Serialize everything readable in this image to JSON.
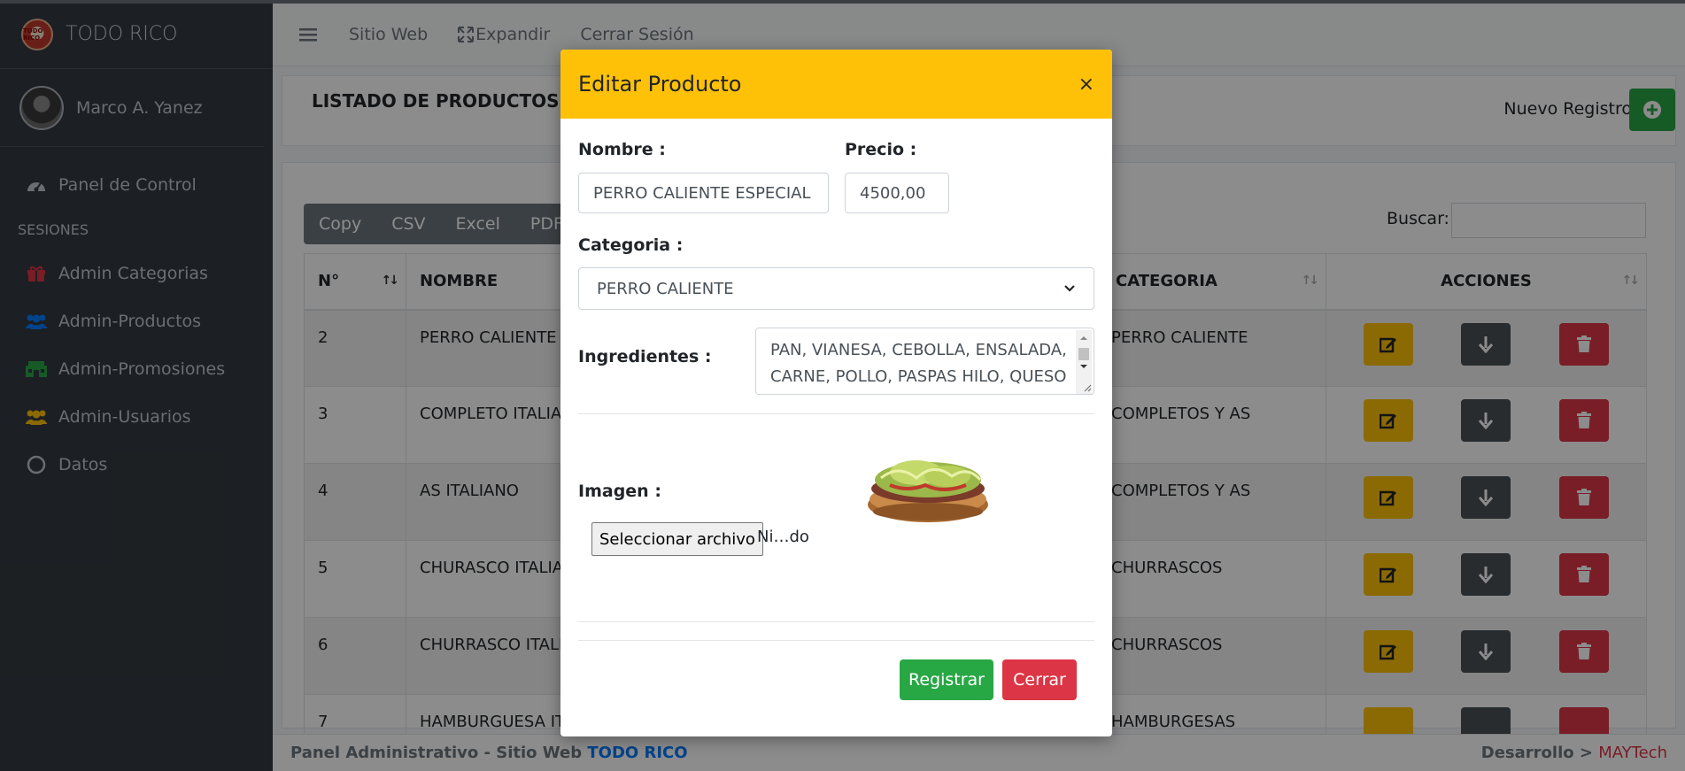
{
  "brand": {
    "name": "TODO RICO",
    "logo_text": "TODO RICO"
  },
  "user": {
    "name": "Marco A. Yanez"
  },
  "sidebar": {
    "items": [
      {
        "label": "Panel de Control",
        "icon": "tachometer-icon"
      },
      {
        "header": "SESIONES"
      },
      {
        "label": "Admin Categorias",
        "icon": "gift-icon",
        "color": "#dc3545"
      },
      {
        "label": "Admin-Productos",
        "icon": "users-icon",
        "color": "#007bff"
      },
      {
        "label": "Admin-Promosiones",
        "icon": "store-icon",
        "color": "#28a745"
      },
      {
        "label": "Admin-Usuarios",
        "icon": "users-icon",
        "color": "#ffc107"
      },
      {
        "label": "Datos",
        "icon": "circle-icon"
      }
    ]
  },
  "navbar": {
    "links": [
      "Sitio Web",
      "Expandir",
      "Cerrar Sesión"
    ]
  },
  "page": {
    "title": "LISTADO DE PRODUCTOS",
    "new_record": "Nuevo Registro",
    "export_buttons": [
      "Copy",
      "CSV",
      "Excel",
      "PDF"
    ],
    "search_label": "Buscar:",
    "columns": [
      "N°",
      "NOMBRE",
      "CATEGORIA",
      "ACCIONES"
    ],
    "rows": [
      {
        "n": "2",
        "nombre": "PERRO CALIENTE E",
        "categoria": "PERRO CALIENTE"
      },
      {
        "n": "3",
        "nombre": "COMPLETO ITALIAN",
        "categoria": "COMPLETOS Y AS"
      },
      {
        "n": "4",
        "nombre": "AS ITALIANO",
        "categoria": "COMPLETOS Y AS"
      },
      {
        "n": "5",
        "nombre": "CHURASCO ITALIAN",
        "categoria": "CHURRASCOS"
      },
      {
        "n": "6",
        "nombre": "CHURRASCO ITALIA",
        "categoria": "CHURRASCOS"
      },
      {
        "n": "7",
        "nombre": "HAMBURGUESA IT",
        "categoria": "HAMBURGESAS"
      }
    ]
  },
  "footer": {
    "left_prefix": "Panel Administrativo - Sitio Web ",
    "left_brand": "TODO RICO",
    "right_prefix": "Desarrollo > ",
    "right_brand": "MAYTech"
  },
  "modal": {
    "title": "Editar Producto",
    "close": "×",
    "nombre_label": "Nombre :",
    "nombre_value": "PERRO CALIENTE ESPECIAL",
    "precio_label": "Precio :",
    "precio_value": "4500,00",
    "categoria_label": "Categoria :",
    "categoria_value": "PERRO CALIENTE",
    "ingredientes_label": "Ingredientes :",
    "ingredientes_line1": "PAN, VIANESA, CEBOLLA, ENSALADA,",
    "ingredientes_line2": "CARNE, POLLO, PASPAS HILO, QUESO",
    "imagen_label": "Imagen :",
    "file_button": "Seleccionar archivo",
    "file_status": "Ni…do",
    "register_button": "Registrar",
    "close_button": "Cerrar"
  },
  "colors": {
    "sidebar_bg": "#343a40",
    "modal_header": "#ffc107",
    "success": "#28a745",
    "danger": "#dc3545",
    "warning": "#ffc107",
    "dark": "#495057"
  }
}
